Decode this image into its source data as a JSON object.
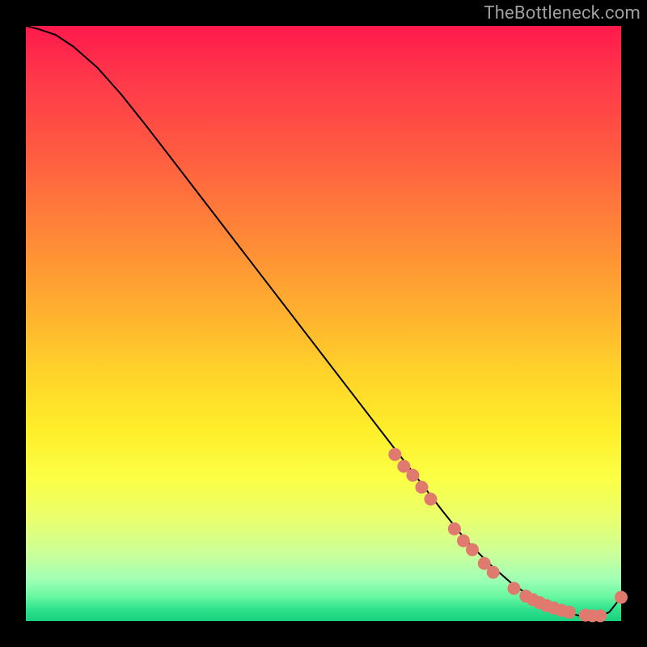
{
  "watermark": "TheBottleneck.com",
  "chart_data": {
    "type": "line",
    "title": "",
    "xlabel": "",
    "ylabel": "",
    "xlim": [
      0,
      100
    ],
    "ylim": [
      0,
      100
    ],
    "grid": false,
    "legend": false,
    "series": [
      {
        "name": "curve",
        "x": [
          0,
          2,
          5,
          8,
          12,
          16,
          20,
          25,
          30,
          35,
          40,
          45,
          50,
          55,
          60,
          65,
          70,
          74,
          78,
          82,
          86,
          90,
          93,
          96,
          98,
          100
        ],
        "y": [
          100,
          99.5,
          98.5,
          96.5,
          93,
          88.5,
          83.5,
          77,
          70.5,
          64,
          57.5,
          51,
          44.5,
          38,
          31.5,
          25,
          18.5,
          13.5,
          9.5,
          6,
          3.5,
          1.7,
          0.9,
          0.7,
          1.5,
          4
        ],
        "color": "#000000",
        "linewidth": 2
      }
    ],
    "scatter": {
      "name": "dots",
      "color": "#e07a6f",
      "radius_px": 8,
      "points": [
        {
          "x": 62,
          "y": 28
        },
        {
          "x": 63.5,
          "y": 26
        },
        {
          "x": 65,
          "y": 24.5
        },
        {
          "x": 66.5,
          "y": 22.5
        },
        {
          "x": 68,
          "y": 20.5
        },
        {
          "x": 72,
          "y": 15.5
        },
        {
          "x": 73.5,
          "y": 13.5
        },
        {
          "x": 75,
          "y": 12
        },
        {
          "x": 77,
          "y": 9.7
        },
        {
          "x": 78.5,
          "y": 8.2
        },
        {
          "x": 82,
          "y": 5.5
        },
        {
          "x": 84,
          "y": 4.2
        },
        {
          "x": 85.2,
          "y": 3.6
        },
        {
          "x": 86.3,
          "y": 3.1
        },
        {
          "x": 87.5,
          "y": 2.6
        },
        {
          "x": 88.7,
          "y": 2.2
        },
        {
          "x": 90,
          "y": 1.8
        },
        {
          "x": 91.3,
          "y": 1.5
        },
        {
          "x": 94,
          "y": 1.0
        },
        {
          "x": 95.2,
          "y": 0.9
        },
        {
          "x": 96.5,
          "y": 0.9
        },
        {
          "x": 100,
          "y": 4
        }
      ]
    }
  }
}
